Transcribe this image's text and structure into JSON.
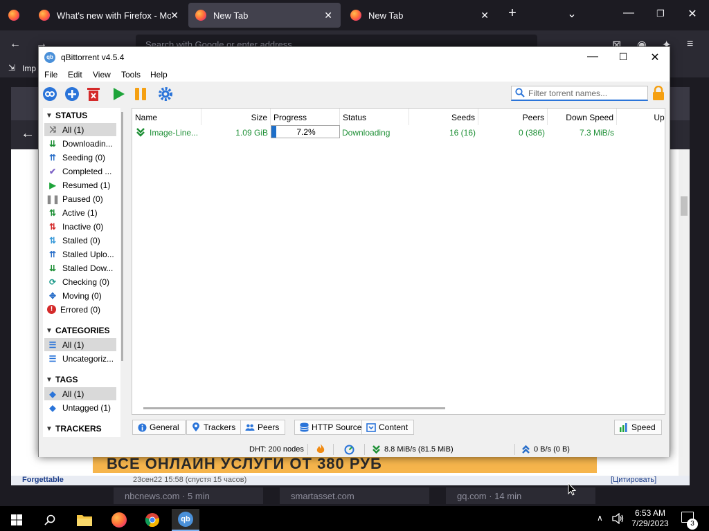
{
  "firefox": {
    "tabs": [
      {
        "label": "What's new with Firefox - More",
        "active": false
      },
      {
        "label": "New Tab",
        "active": true
      },
      {
        "label": "New Tab",
        "active": false
      }
    ],
    "url_placeholder": "Search with Google or enter address",
    "bookmark_label": "Imp",
    "newtab_cards": [
      "nbcnews.com · 5 min",
      "smartasset.com",
      "gq.com · 14 min"
    ],
    "forum_snippet": "Forgettable",
    "forum_date": "23сен22 15:58  (спустя 15 часов)",
    "forum_quote": "[Цитировать]",
    "ad_text": "ВСЕ ОНЛАЙН УСЛУГИ ОТ 380 РУБ"
  },
  "qbt": {
    "title": "qBittorrent v4.5.4",
    "menu": [
      "File",
      "Edit",
      "View",
      "Tools",
      "Help"
    ],
    "filter_placeholder": "Filter torrent names...",
    "status_header": "STATUS",
    "status_items": [
      {
        "label": "All (1)",
        "icon": "shuffle-icon",
        "color": "#555555",
        "selected": true
      },
      {
        "label": "Downloadin...",
        "icon": "download-icon",
        "color": "#1d8f35"
      },
      {
        "label": "Seeding (0)",
        "icon": "upload-icon",
        "color": "#2a6fc9"
      },
      {
        "label": "Completed ...",
        "icon": "check-icon",
        "color": "#7b5fc4"
      },
      {
        "label": "Resumed (1)",
        "icon": "play-icon",
        "color": "#1ea43a"
      },
      {
        "label": "Paused (0)",
        "icon": "pause-icon",
        "color": "#888888"
      },
      {
        "label": "Active (1)",
        "icon": "active-icon",
        "color": "#1d8f35"
      },
      {
        "label": "Inactive (0)",
        "icon": "inactive-icon",
        "color": "#d42a2a"
      },
      {
        "label": "Stalled (0)",
        "icon": "stalled-icon",
        "color": "#3a9ad9"
      },
      {
        "label": "Stalled Uplo...",
        "icon": "stalled-up-icon",
        "color": "#2a6fc9"
      },
      {
        "label": "Stalled Dow...",
        "icon": "stalled-down-icon",
        "color": "#1d8f35"
      },
      {
        "label": "Checking (0)",
        "icon": "checking-icon",
        "color": "#1e9a8a"
      },
      {
        "label": "Moving (0)",
        "icon": "moving-icon",
        "color": "#2a6fc9"
      },
      {
        "label": "Errored (0)",
        "icon": "error-icon",
        "color": "#d42a2a"
      }
    ],
    "categories_header": "CATEGORIES",
    "category_items": [
      {
        "label": "All (1)",
        "selected": true
      },
      {
        "label": "Uncategoriz..."
      }
    ],
    "tags_header": "TAGS",
    "tag_items": [
      {
        "label": "All (1)",
        "selected": true
      },
      {
        "label": "Untagged (1)"
      }
    ],
    "trackers_header": "TRACKERS",
    "columns": [
      "Name",
      "Size",
      "Progress",
      "Status",
      "Seeds",
      "Peers",
      "Down Speed",
      "Up S"
    ],
    "torrents": [
      {
        "name": "Image-Line...",
        "size": "1.09 GiB",
        "progress": 0.072,
        "progress_text": "7.2%",
        "status": "Downloading",
        "seeds": "16 (16)",
        "peers": "0 (386)",
        "down_speed": "7.3 MiB/s"
      }
    ],
    "bottom_tabs": [
      "General",
      "Trackers",
      "Peers",
      "HTTP Sources",
      "Content"
    ],
    "speed_tab": "Speed",
    "statusbar": {
      "dht": "DHT: 200 nodes",
      "down": "8.8 MiB/s (81.5 MiB)",
      "up": "0 B/s (0 B)"
    }
  },
  "taskbar": {
    "time": "6:53 AM",
    "date": "7/29/2023",
    "notifications": "3"
  },
  "colors": {
    "accent": "#2a74d9",
    "download_green": "#1d8f35",
    "progress_blue": "#1e6fc9"
  }
}
